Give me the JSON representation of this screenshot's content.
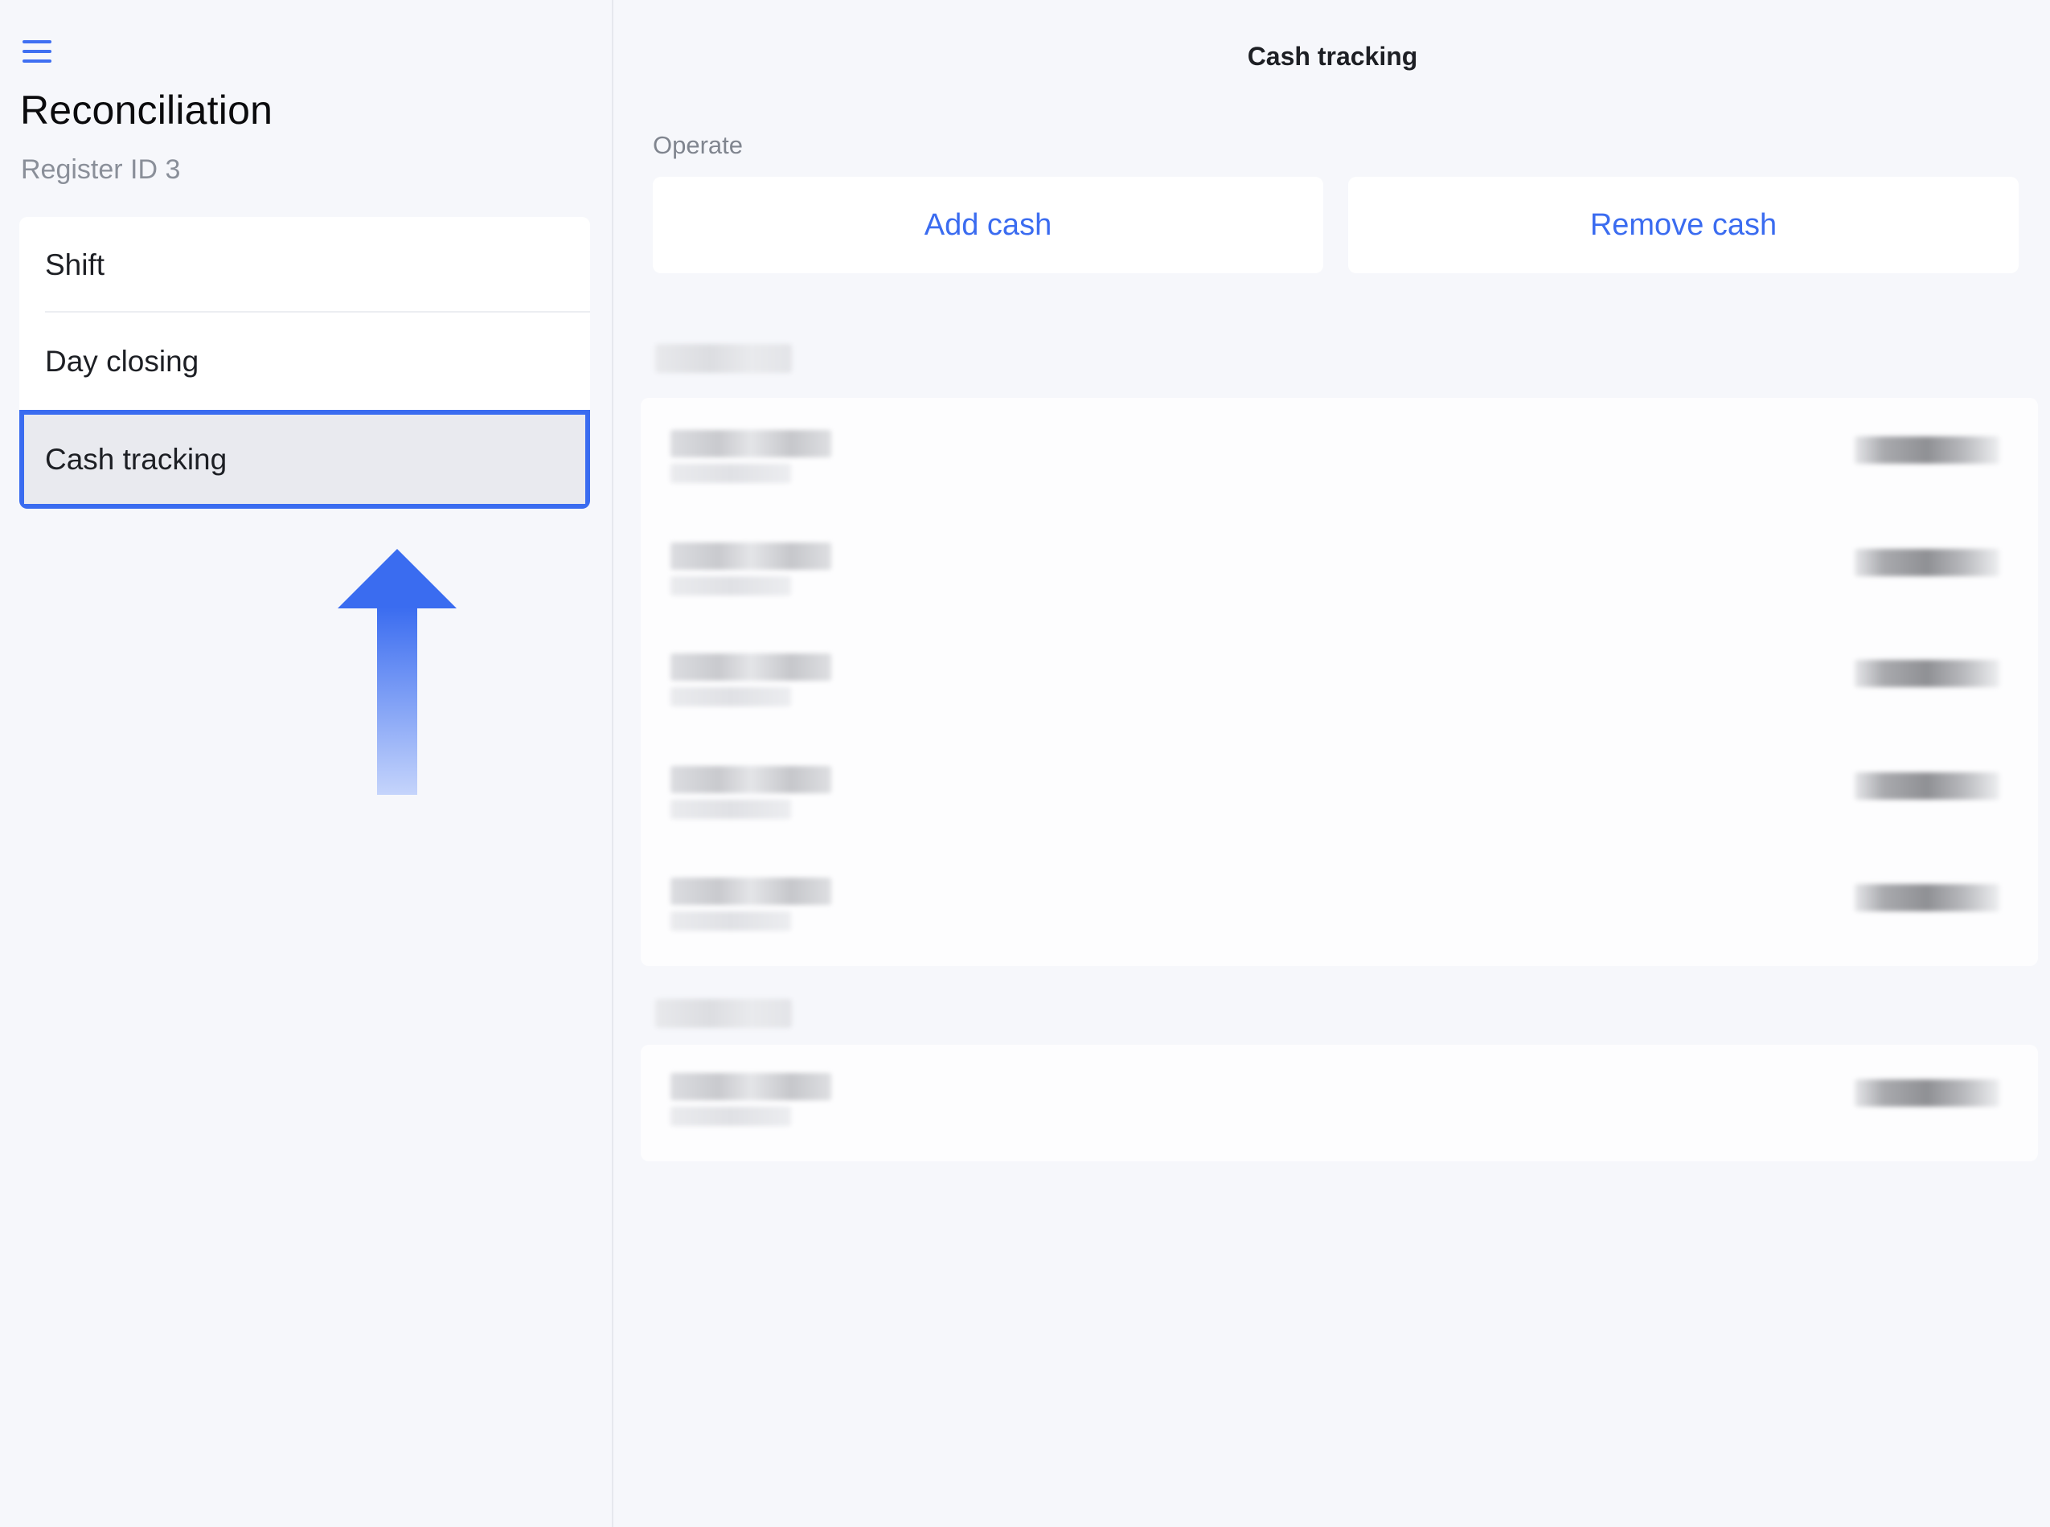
{
  "sidebar": {
    "menu_icon": "hamburger-menu-icon",
    "title": "Reconciliation",
    "subtitle": "Register ID 3",
    "items": [
      {
        "label": "Shift"
      },
      {
        "label": "Day closing"
      },
      {
        "label": "Cash tracking",
        "selected": true
      }
    ],
    "pointer_icon": "up-arrow-icon"
  },
  "main": {
    "title": "Cash tracking",
    "operate_label": "Operate",
    "add_cash_label": "Add cash",
    "remove_cash_label": "Remove cash"
  },
  "colors": {
    "accent": "#3b6cf0",
    "background": "#f6f7fb",
    "selection_border": "#3a6cf0"
  }
}
